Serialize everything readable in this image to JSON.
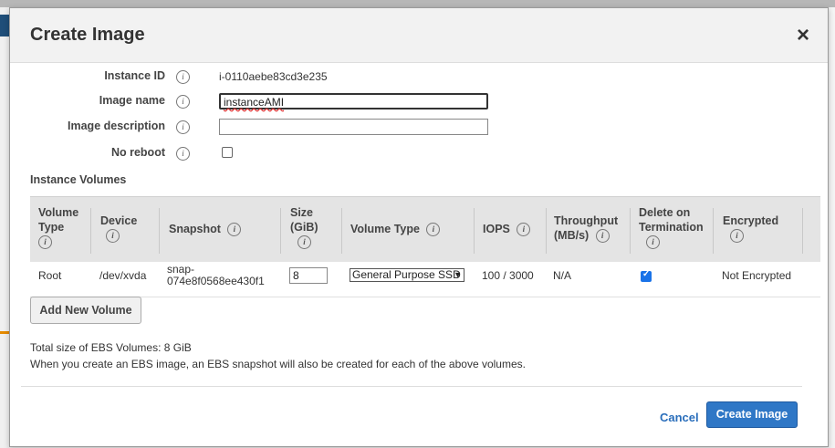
{
  "dialog": {
    "title": "Create Image",
    "close_glyph": "×"
  },
  "form": {
    "instance_id_label": "Instance ID",
    "instance_id_value": "i-0110aebe83cd3e235",
    "image_name_label": "Image name",
    "image_name_value": "instanceAMI",
    "image_description_label": "Image description",
    "image_description_value": "",
    "no_reboot_label": "No reboot",
    "no_reboot_checked": false
  },
  "volumes": {
    "section_title": "Instance Volumes",
    "headers": {
      "volume_type_l1": "Volume",
      "volume_type_l2": "Type",
      "device": "Device",
      "snapshot": "Snapshot",
      "size_l1": "Size",
      "size_l2": "(GiB)",
      "vol_type": "Volume Type",
      "iops": "IOPS",
      "throughput_l1": "Throughput",
      "throughput_l2": "(MB/s)",
      "delete_l1": "Delete on",
      "delete_l2": "Termination",
      "encrypted": "Encrypted"
    },
    "rows": [
      {
        "volume_type": "Root",
        "device": "/dev/xvda",
        "snapshot_l1": "snap-",
        "snapshot_l2": "074e8f0568ee430f1",
        "size": "8",
        "vol_type": "General Purpose SSD",
        "iops": "100 / 3000",
        "throughput": "N/A",
        "delete_on_termination": true,
        "encrypted": "Not Encrypted"
      }
    ],
    "add_button": "Add New Volume"
  },
  "summary": {
    "total": "Total size of EBS Volumes: 8 GiB",
    "note": "When you create an EBS image, an EBS snapshot will also be created for each of the above volumes."
  },
  "footer": {
    "cancel": "Cancel",
    "create": "Create Image"
  },
  "icons": {
    "info": "i"
  },
  "colors": {
    "primary": "#2f77c6",
    "link": "#2a6ebb",
    "header_bg": "#f2f2f2",
    "table_header_bg": "#e4e4e4"
  }
}
